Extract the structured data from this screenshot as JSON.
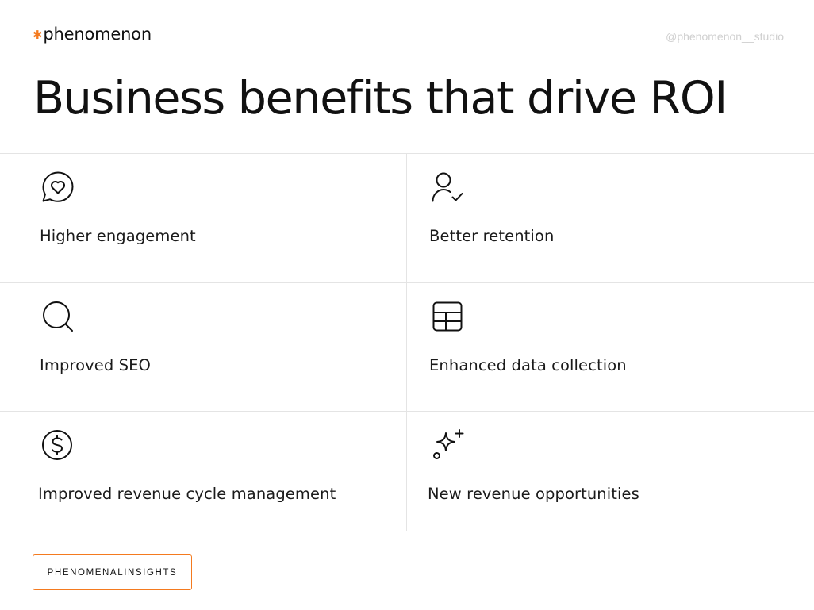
{
  "header": {
    "logo_text": "phenomenon",
    "logo_mark": "✱",
    "handle": "@phenomenon__studio"
  },
  "headline": "Business benefits that drive ROI",
  "benefits": [
    {
      "icon": "heart-chat-icon",
      "label": "Higher engagement"
    },
    {
      "icon": "user-check-icon",
      "label": "Better retention"
    },
    {
      "icon": "search-icon",
      "label": "Improved SEO"
    },
    {
      "icon": "table-grid-icon",
      "label": "Enhanced data collection"
    },
    {
      "icon": "dollar-circle-icon",
      "label": "Improved revenue cycle management"
    },
    {
      "icon": "sparkles-icon",
      "label": "New revenue opportunities"
    }
  ],
  "footer": {
    "tag": "PHENOMENALINSIGHTS"
  },
  "colors": {
    "accent": "#f47a1f",
    "text": "#111111",
    "muted": "#cfcfcf",
    "divider": "#e4e4e4"
  }
}
